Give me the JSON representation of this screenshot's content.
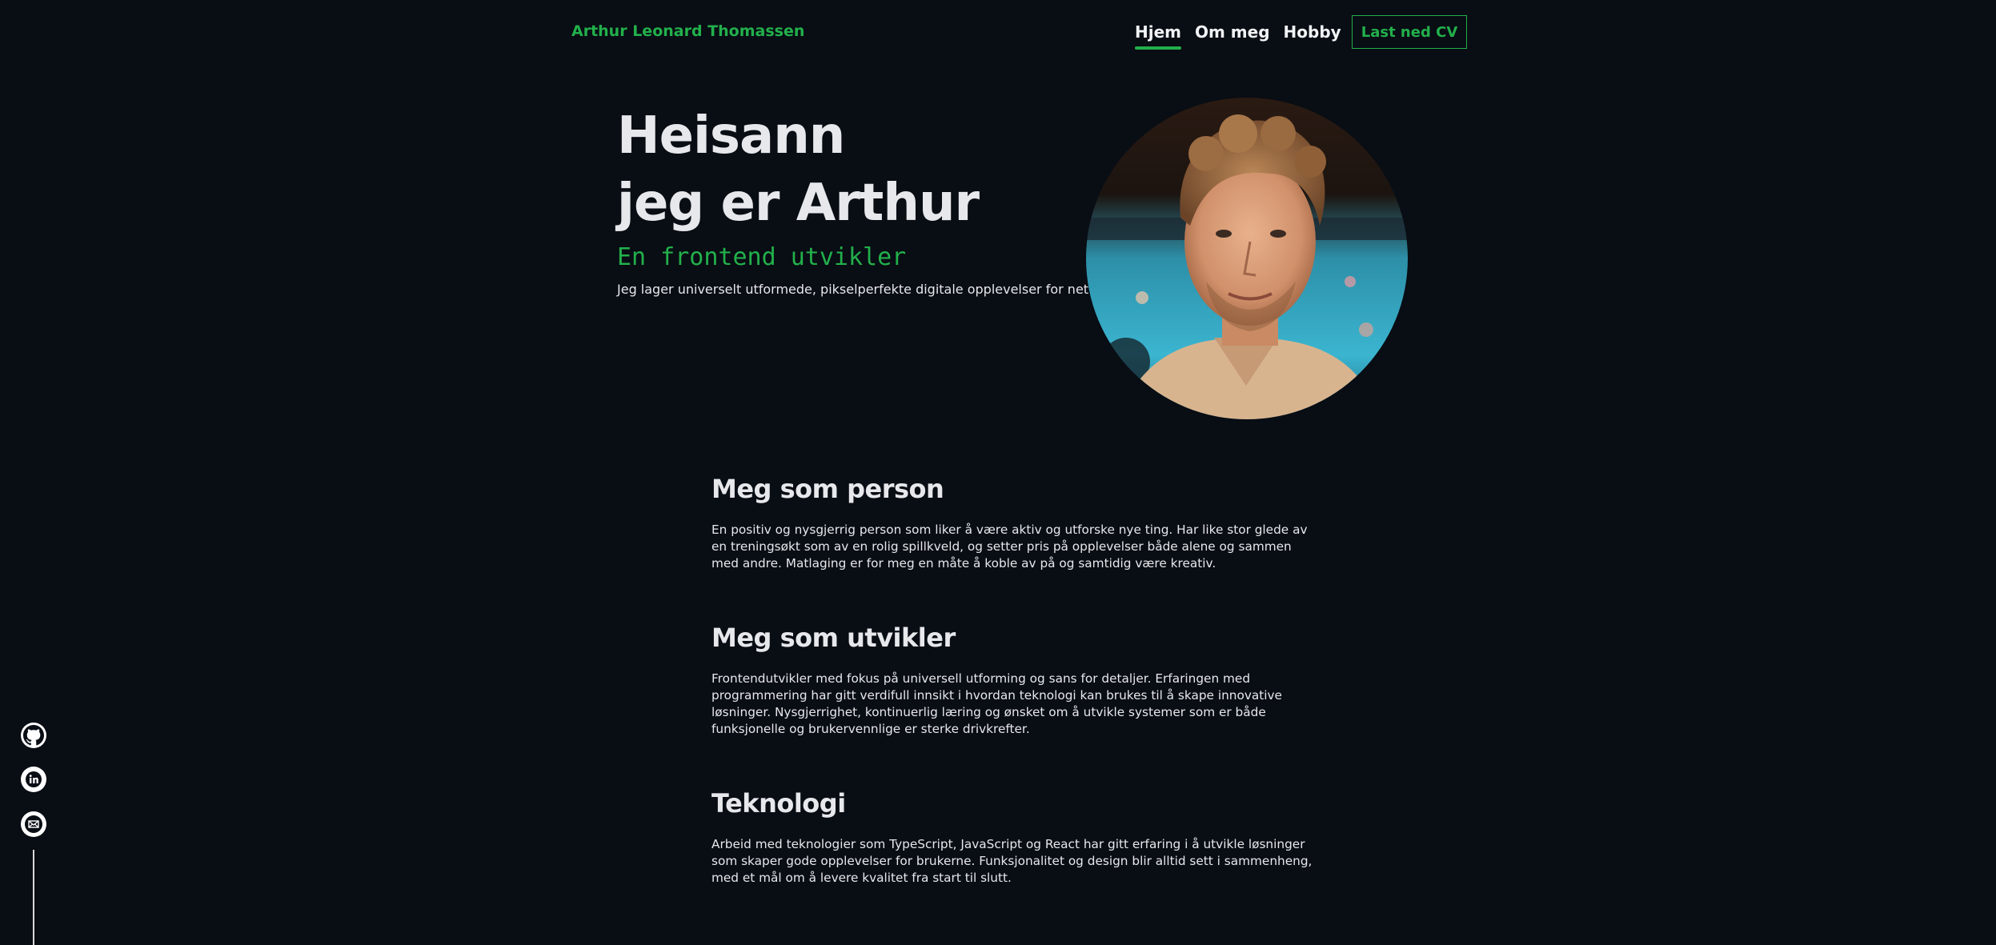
{
  "header": {
    "brand": "Arthur Leonard Thomassen",
    "nav": [
      {
        "label": "Hjem",
        "active": true
      },
      {
        "label": "Om meg",
        "active": false
      },
      {
        "label": "Hobby",
        "active": false
      }
    ],
    "cv_button": "Last ned CV"
  },
  "hero": {
    "line1": "Heisann",
    "line2": "jeg er Arthur",
    "role": "En frontend utvikler",
    "tagline": "Jeg lager universelt utformede, pikselperfekte digitale opplevelser for nettet."
  },
  "sections": [
    {
      "title": "Meg som person",
      "body": "En positiv og nysgjerrig person som liker å være aktiv og utforske nye ting. Har like stor glede av en treningsøkt som av en rolig spillkveld, og setter pris på opplevelser både alene og sammen med andre. Matlaging er for meg en måte å koble av på og samtidig være kreativ."
    },
    {
      "title": "Meg som utvikler",
      "body": "Frontendutvikler med fokus på universell utforming og sans for detaljer. Erfaringen med programmering har gitt verdifull innsikt i hvordan teknologi kan brukes til å skape innovative løsninger. Nysgjerrighet, kontinuerlig læring og ønsket om å utvikle systemer som er både funksjonelle og brukervennlige er sterke drivkrefter."
    },
    {
      "title": "Teknologi",
      "body": "Arbeid med teknologier som TypeScript, JavaScript og React har gitt erfaring i å utvikle løsninger som skaper gode opplevelser for brukerne. Funksjonalitet og design blir alltid sett i sammenheng, med et mål om å levere kvalitet fra start til slutt."
    }
  ],
  "social": {
    "icons": [
      "github-icon",
      "linkedin-icon",
      "mail-icon"
    ]
  },
  "colors": {
    "background": "#090d14",
    "accent": "#22b04b",
    "text": "#e6e8eb"
  }
}
